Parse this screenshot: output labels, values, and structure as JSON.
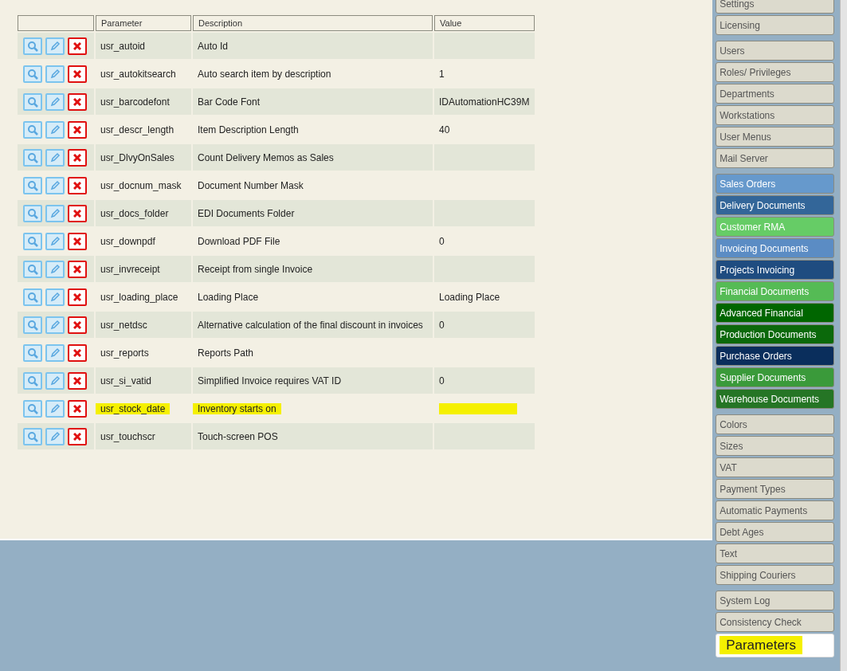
{
  "table": {
    "columns": [
      "Parameter",
      "Description",
      "Value"
    ],
    "rows": [
      {
        "parameter": "usr_autoid",
        "description": "Auto Id",
        "value": "",
        "highlighted": false
      },
      {
        "parameter": "usr_autokitsearch",
        "description": "Auto search item by description",
        "value": "1",
        "highlighted": false
      },
      {
        "parameter": "usr_barcodefont",
        "description": "Bar Code Font",
        "value": "IDAutomationHC39M",
        "highlighted": false
      },
      {
        "parameter": "usr_descr_length",
        "description": "Item Description Length",
        "value": "40",
        "highlighted": false
      },
      {
        "parameter": "usr_DlvyOnSales",
        "description": "Count Delivery Memos as Sales",
        "value": "",
        "highlighted": false
      },
      {
        "parameter": "usr_docnum_mask",
        "description": "Document Number Mask",
        "value": "",
        "highlighted": false
      },
      {
        "parameter": "usr_docs_folder",
        "description": "EDI Documents Folder",
        "value": "",
        "highlighted": false
      },
      {
        "parameter": "usr_downpdf",
        "description": "Download PDF File",
        "value": "0",
        "highlighted": false
      },
      {
        "parameter": "usr_invreceipt",
        "description": "Receipt from single Invoice",
        "value": "",
        "highlighted": false
      },
      {
        "parameter": "usr_loading_place",
        "description": "Loading Place",
        "value": "Loading Place",
        "highlighted": false
      },
      {
        "parameter": "usr_netdsc",
        "description": "Alternative calculation of the final discount in invoices",
        "value": "0",
        "highlighted": false
      },
      {
        "parameter": "usr_reports",
        "description": "Reports Path",
        "value": "",
        "highlighted": false
      },
      {
        "parameter": "usr_si_vatid",
        "description": "Simplified Invoice requires VAT ID",
        "value": "0",
        "highlighted": false
      },
      {
        "parameter": "usr_stock_date",
        "description": "Inventory starts on",
        "value": "",
        "highlighted": true
      },
      {
        "parameter": "usr_touchscr",
        "description": "Touch-screen POS",
        "value": "",
        "highlighted": false
      }
    ]
  },
  "sidebar": {
    "groups": [
      {
        "items": [
          {
            "label": "Settings",
            "selected": false
          },
          {
            "label": "Licensing",
            "selected": false
          }
        ]
      },
      {
        "items": [
          {
            "label": "Users",
            "selected": false
          },
          {
            "label": "Roles/ Privileges",
            "selected": false
          },
          {
            "label": "Departments",
            "selected": false
          },
          {
            "label": "Workstations",
            "selected": false
          },
          {
            "label": "User Menus",
            "selected": false
          },
          {
            "label": "Mail Server",
            "selected": false
          }
        ]
      },
      {
        "items": [
          {
            "label": "Sales Orders",
            "selected": false,
            "color": "#6699cc"
          },
          {
            "label": "Delivery Documents",
            "selected": false,
            "color": "#336699"
          },
          {
            "label": "Customer RMA",
            "selected": false,
            "color": "#66cc66"
          },
          {
            "label": "Invoicing Documents",
            "selected": false,
            "color": "#5b8cc4"
          },
          {
            "label": "Projects Invoicing",
            "selected": false,
            "color": "#1f4c80"
          },
          {
            "label": "Financial Documents",
            "selected": false,
            "color": "#55bb55"
          },
          {
            "label": "Advanced Financial",
            "selected": false,
            "color": "#006600"
          },
          {
            "label": "Production Documents",
            "selected": false,
            "color": "#0b690b"
          },
          {
            "label": "Purchase Orders",
            "selected": false,
            "color": "#0a2e5c"
          },
          {
            "label": "Supplier Documents",
            "selected": false,
            "color": "#3a9a3a"
          },
          {
            "label": "Warehouse Documents",
            "selected": false,
            "color": "#257525"
          }
        ]
      },
      {
        "items": [
          {
            "label": "Colors",
            "selected": false
          },
          {
            "label": "Sizes",
            "selected": false
          },
          {
            "label": "VAT",
            "selected": false
          },
          {
            "label": "Payment Types",
            "selected": false
          },
          {
            "label": "Automatic Payments",
            "selected": false
          },
          {
            "label": "Debt Ages",
            "selected": false
          },
          {
            "label": "Text",
            "selected": false
          },
          {
            "label": "Shipping Couriers",
            "selected": false
          }
        ]
      },
      {
        "items": [
          {
            "label": "System Log",
            "selected": false
          },
          {
            "label": "Consistency Check",
            "selected": false
          },
          {
            "label": "Parameters",
            "selected": true,
            "highlighted": true
          }
        ]
      }
    ]
  }
}
